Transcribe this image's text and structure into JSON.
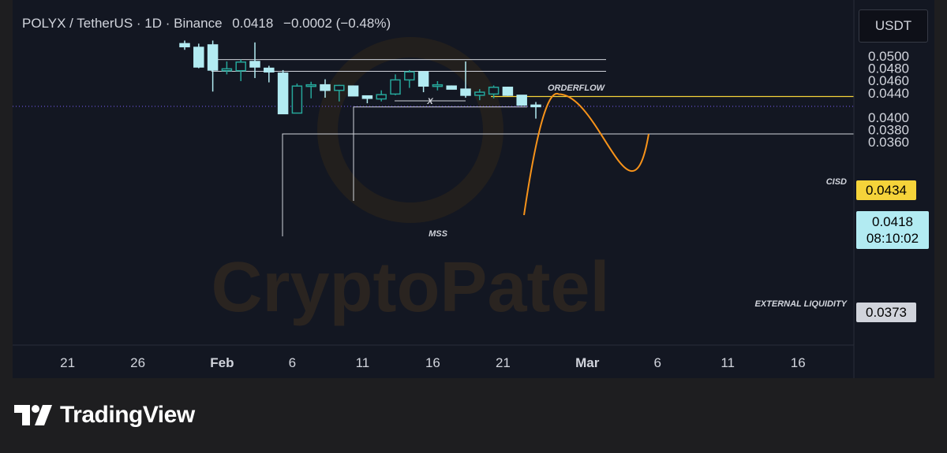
{
  "header": {
    "symbol": "POLYX / TetherUS · 1D · Binance",
    "price": "0.0418",
    "change": "−0.0002 (−0.48%)"
  },
  "currency_button": "USDT",
  "price_labels": {
    "cisd": "0.0434",
    "last": "0.0418",
    "countdown": "08:10:02",
    "external_liquidity": "0.0373"
  },
  "annotations": {
    "orderflow": "ORDERFLOW",
    "x_mark": "X",
    "mss": "MSS",
    "cisd": "CISD",
    "external_liquidity": "EXTERNAL LIQUIDITY"
  },
  "watermark": "CryptoPatel",
  "brand": "TradingView",
  "colors": {
    "background": "#131722",
    "bull_candle": "#26a69a",
    "bear_candle": "#b2ebf2",
    "cisd_line": "#f5d33a",
    "projection": "#f7931a",
    "text": "#d1d4dc"
  },
  "chart_data": {
    "type": "candlestick",
    "interval": "1D",
    "x_tick_labels": [
      "21",
      "26",
      "Feb",
      "6",
      "11",
      "16",
      "21",
      "Mar",
      "6",
      "11",
      "16"
    ],
    "y_tick_labels": [
      "0.0500",
      "0.0480",
      "0.0460",
      "0.0440",
      "0.0400",
      "0.0380",
      "0.0360"
    ],
    "ylim": [
      0.0357,
      0.0515
    ],
    "candles": [
      {
        "date": "Jan 29",
        "open": 0.052,
        "high": 0.0525,
        "low": 0.051,
        "close": 0.0515
      },
      {
        "date": "Jan 30",
        "open": 0.0514,
        "high": 0.052,
        "low": 0.048,
        "close": 0.0482
      },
      {
        "date": "Jan 31",
        "open": 0.0518,
        "high": 0.0525,
        "low": 0.0442,
        "close": 0.0477
      },
      {
        "date": "Feb 1",
        "open": 0.0476,
        "high": 0.0491,
        "low": 0.047,
        "close": 0.0479
      },
      {
        "date": "Feb 2",
        "open": 0.0476,
        "high": 0.0494,
        "low": 0.0459,
        "close": 0.049
      },
      {
        "date": "Feb 3",
        "open": 0.0491,
        "high": 0.0522,
        "low": 0.0464,
        "close": 0.0482
      },
      {
        "date": "Feb 4",
        "open": 0.048,
        "high": 0.0484,
        "low": 0.0457,
        "close": 0.0474
      },
      {
        "date": "Feb 5",
        "open": 0.0472,
        "high": 0.0477,
        "low": 0.0407,
        "close": 0.0406
      },
      {
        "date": "Feb 6",
        "open": 0.0407,
        "high": 0.0455,
        "low": 0.0407,
        "close": 0.0451
      },
      {
        "date": "Feb 7",
        "open": 0.0452,
        "high": 0.0458,
        "low": 0.0431,
        "close": 0.0453
      },
      {
        "date": "Feb 8",
        "open": 0.0453,
        "high": 0.0462,
        "low": 0.0432,
        "close": 0.0444
      },
      {
        "date": "Feb 9",
        "open": 0.0444,
        "high": 0.0453,
        "low": 0.0426,
        "close": 0.0452
      },
      {
        "date": "Feb 10",
        "open": 0.0451,
        "high": 0.0452,
        "low": 0.0435,
        "close": 0.0435
      },
      {
        "date": "Feb 11",
        "open": 0.0435,
        "high": 0.0435,
        "low": 0.0423,
        "close": 0.0431
      },
      {
        "date": "Feb 12",
        "open": 0.043,
        "high": 0.0444,
        "low": 0.0426,
        "close": 0.0437
      },
      {
        "date": "Feb 13",
        "open": 0.0438,
        "high": 0.047,
        "low": 0.0436,
        "close": 0.0461
      },
      {
        "date": "Feb 14",
        "open": 0.0461,
        "high": 0.0477,
        "low": 0.0448,
        "close": 0.0474
      },
      {
        "date": "Feb 15",
        "open": 0.0474,
        "high": 0.0474,
        "low": 0.0441,
        "close": 0.0451
      },
      {
        "date": "Feb 16",
        "open": 0.0451,
        "high": 0.0459,
        "low": 0.0444,
        "close": 0.0453
      },
      {
        "date": "Feb 17",
        "open": 0.0451,
        "high": 0.0452,
        "low": 0.0446,
        "close": 0.0446
      },
      {
        "date": "Feb 18",
        "open": 0.0446,
        "high": 0.0491,
        "low": 0.0432,
        "close": 0.0436
      },
      {
        "date": "Feb 19",
        "open": 0.0436,
        "high": 0.0446,
        "low": 0.0428,
        "close": 0.0441
      },
      {
        "date": "Feb 20",
        "open": 0.0438,
        "high": 0.0452,
        "low": 0.0431,
        "close": 0.0449
      },
      {
        "date": "Feb 21",
        "open": 0.0449,
        "high": 0.045,
        "low": 0.0435,
        "close": 0.0436
      },
      {
        "date": "Feb 22",
        "open": 0.0436,
        "high": 0.0436,
        "low": 0.0419,
        "close": 0.042
      },
      {
        "date": "Feb 23",
        "open": 0.042,
        "high": 0.0425,
        "low": 0.0398,
        "close": 0.0418
      }
    ],
    "levels": {
      "orderflow_top": 0.0494,
      "orderflow_bottom": 0.0475,
      "cisd": 0.0434,
      "mss": 0.0417,
      "external_liquidity": 0.0373,
      "last_price": 0.0418
    },
    "projection": {
      "start_date": "Feb 23",
      "peak_price": 0.0434,
      "end_price": 0.0373
    }
  }
}
